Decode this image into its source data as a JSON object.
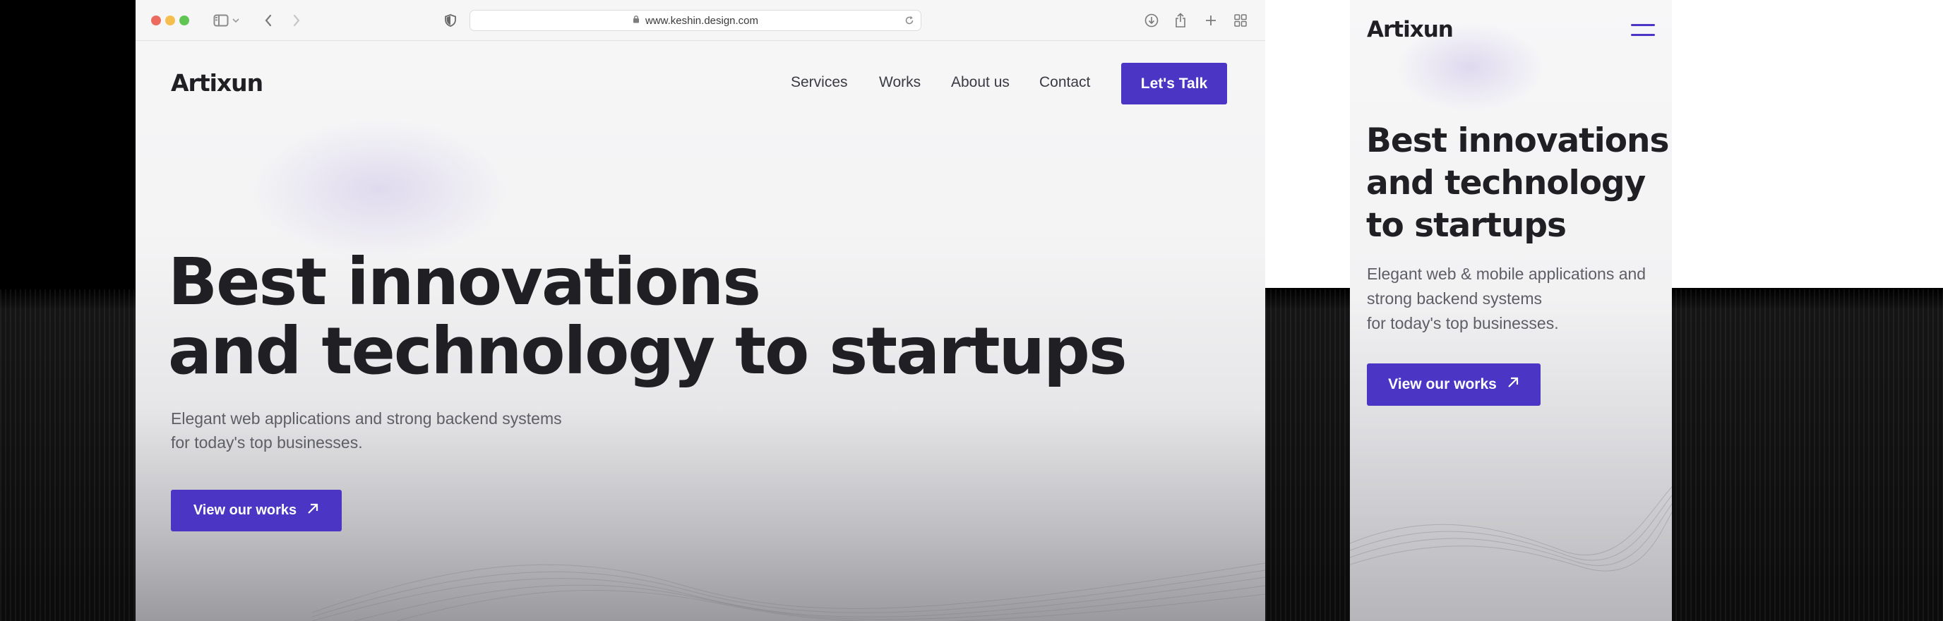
{
  "browser": {
    "url": "www.keshin.design.com"
  },
  "desktop": {
    "logo": "Artixun",
    "nav": [
      {
        "label": "Services"
      },
      {
        "label": "Works"
      },
      {
        "label": "About us"
      },
      {
        "label": "Contact"
      }
    ],
    "cta_label": "Let's Talk",
    "hero": {
      "title_line1": "Best innovations",
      "title_line2": "and technology to startups",
      "subtitle_line1": "Elegant web applications and strong backend systems",
      "subtitle_line2": "for today's top businesses.",
      "button_label": "View our works"
    }
  },
  "mobile": {
    "logo": "Artixun",
    "hero": {
      "title_line1": "Best innovations",
      "title_line2": "and technology",
      "title_line3": "to startups",
      "subtitle_line1": "Elegant web & mobile applications and",
      "subtitle_line2": "strong backend systems",
      "subtitle_line3": "for today's top businesses.",
      "button_label": "View our works"
    }
  },
  "colors": {
    "accent": "#4a35c4",
    "heading": "#1f1f24",
    "body_text": "#5e5e66"
  },
  "icons": [
    "sidebar-icon",
    "chevron-down-icon",
    "back-arrow-icon",
    "forward-arrow-icon",
    "shield-icon",
    "lock-icon",
    "reload-icon",
    "download-icon",
    "share-icon",
    "plus-icon",
    "tabs-grid-icon",
    "arrow-up-right-icon",
    "hamburger-menu-icon"
  ]
}
